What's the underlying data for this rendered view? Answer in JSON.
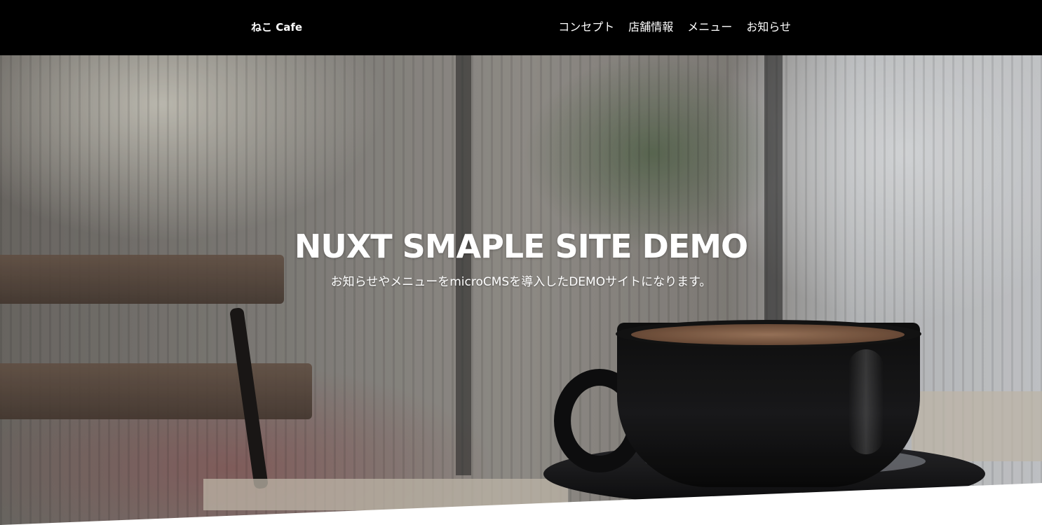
{
  "header": {
    "logo": "ねこ Cafe",
    "nav": [
      {
        "label": "コンセプト"
      },
      {
        "label": "店舗情報"
      },
      {
        "label": "メニュー"
      },
      {
        "label": "お知らせ"
      }
    ]
  },
  "hero": {
    "title": "NUXT SMAPLE SITE DEMO",
    "subtitle": "お知らせやメニューをmicroCMSを導入したDEMOサイトになります。"
  },
  "colors": {
    "header_bg": "#000000",
    "text": "#ffffff",
    "page_bg": "#ffffff"
  }
}
